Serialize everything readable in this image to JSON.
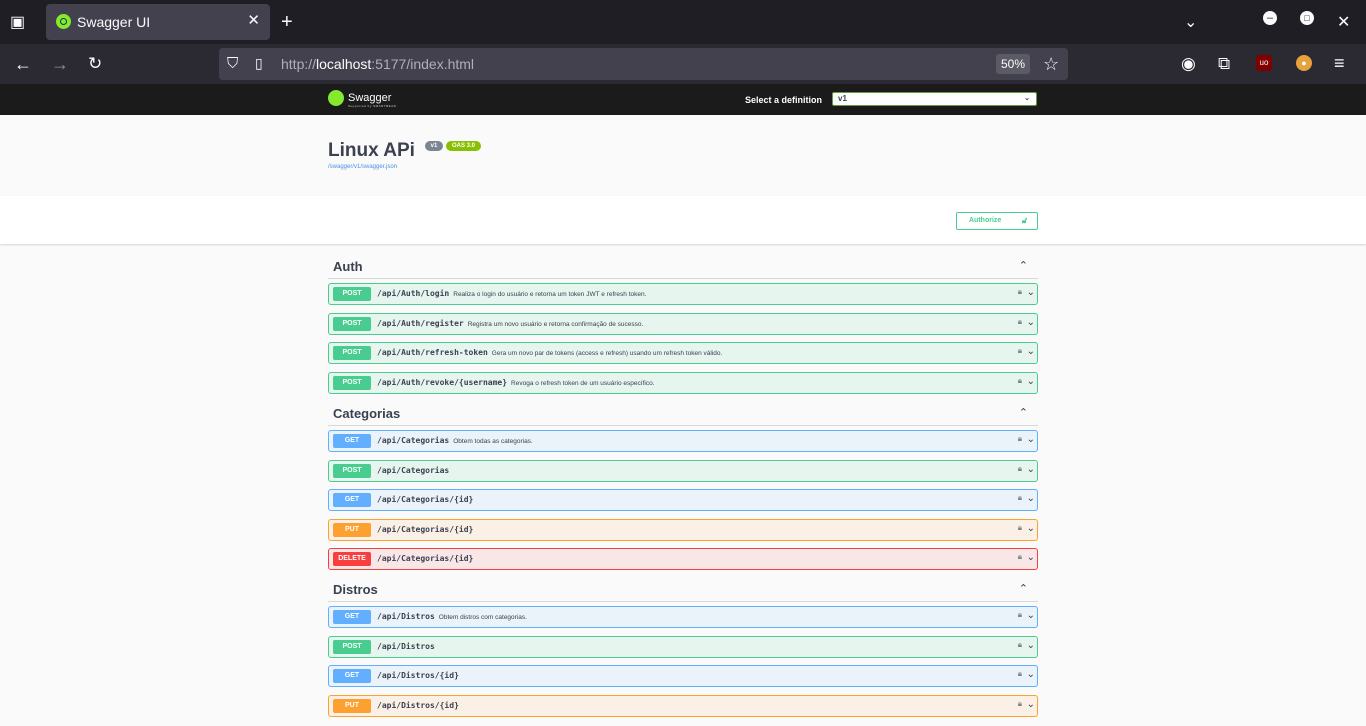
{
  "browser": {
    "tab_title": "Swagger UI",
    "url_host": "localhost",
    "url_prefix": "http://",
    "url_rest": ":5177/index.html",
    "zoom": "50%"
  },
  "swagger": {
    "brand": "Swagger",
    "brand_sub": "Supported by SMARTBEAR",
    "definition_label": "Select a definition",
    "definition_value": "v1",
    "api_title": "Linux APi",
    "version_badge": "v1",
    "oas_badge": "OAS 3.0",
    "spec_url": "/swagger/v1/swagger.json",
    "authorize_label": "Authorize"
  },
  "tags": [
    {
      "name": "Auth",
      "ops": [
        {
          "method": "POST",
          "path": "/api/Auth/login",
          "desc": "Realiza o login do usuário e retorna um token JWT e refresh token."
        },
        {
          "method": "POST",
          "path": "/api/Auth/register",
          "desc": "Registra um novo usuário e retorna confirmação de sucesso."
        },
        {
          "method": "POST",
          "path": "/api/Auth/refresh-token",
          "desc": "Gera um novo par de tokens (access e refresh) usando um refresh token válido."
        },
        {
          "method": "POST",
          "path": "/api/Auth/revoke/{username}",
          "desc": "Revoga o refresh token de um usuário específico."
        }
      ]
    },
    {
      "name": "Categorias",
      "ops": [
        {
          "method": "GET",
          "path": "/api/Categorias",
          "desc": "Obtem todas as categorias."
        },
        {
          "method": "POST",
          "path": "/api/Categorias",
          "desc": ""
        },
        {
          "method": "GET",
          "path": "/api/Categorias/{id}",
          "desc": ""
        },
        {
          "method": "PUT",
          "path": "/api/Categorias/{id}",
          "desc": ""
        },
        {
          "method": "DELETE",
          "path": "/api/Categorias/{id}",
          "desc": ""
        }
      ]
    },
    {
      "name": "Distros",
      "ops": [
        {
          "method": "GET",
          "path": "/api/Distros",
          "desc": "Obtem distros com categorias."
        },
        {
          "method": "POST",
          "path": "/api/Distros",
          "desc": ""
        },
        {
          "method": "GET",
          "path": "/api/Distros/{id}",
          "desc": ""
        },
        {
          "method": "PUT",
          "path": "/api/Distros/{id}",
          "desc": ""
        }
      ]
    }
  ]
}
